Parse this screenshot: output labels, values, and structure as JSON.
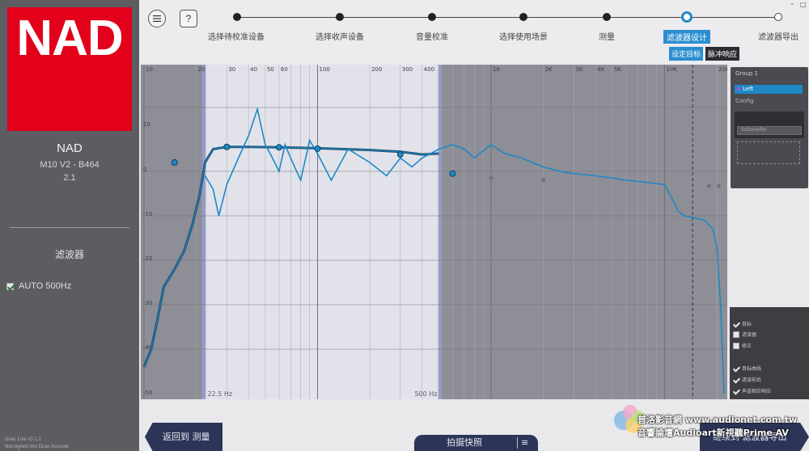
{
  "sidebar": {
    "logo_text": "NAD",
    "device_brand": "NAD",
    "device_model": "M10 V2 - B464",
    "device_channels": "2.1",
    "filters_heading": "滤波器",
    "filters": [
      {
        "label": "AUTO 500Hz",
        "checked": true
      }
    ],
    "footer_version": "Dirac Live v3.1.2",
    "footer_login": "Not signed into Dirac Account"
  },
  "header": {
    "menu_icon": "menu-icon",
    "help_label": "?",
    "window_min": "–",
    "window_max": "□",
    "steps": [
      {
        "label": "选择待校准设备",
        "state": "done"
      },
      {
        "label": "选择收声设备",
        "state": "done"
      },
      {
        "label": "音量校准",
        "state": "done"
      },
      {
        "label": "选择使用场景",
        "state": "done"
      },
      {
        "label": "测量",
        "state": "done"
      },
      {
        "label": "滤波器设计",
        "state": "active"
      },
      {
        "label": "滤波器导出",
        "state": "future"
      }
    ],
    "subtabs": {
      "target": "设定目标",
      "impulse": "脉冲响应"
    }
  },
  "plot": {
    "x_ticks": [
      "10",
      "20",
      "30",
      "40",
      "50",
      "60",
      "100",
      "200",
      "300",
      "400",
      "1K",
      "2K",
      "3K",
      "4K",
      "5K",
      "10K",
      "20K"
    ],
    "y_ticks": [
      "10",
      "0",
      "-10",
      "-20",
      "-30",
      "-40",
      "-50"
    ],
    "y_top_label": "10",
    "marker_low": "22.5 Hz",
    "marker_high": "500 Hz",
    "colors": {
      "response": "#1e88c7",
      "target": "#1f4e6e",
      "corrected": "#1e88c7"
    }
  },
  "chart_data": {
    "type": "line",
    "x_scale": "log",
    "xlim": [
      10,
      22000
    ],
    "ylim": [
      -50,
      15
    ],
    "correction_range": [
      22.5,
      500
    ],
    "series": [
      {
        "points": [
          [
            10,
            -44
          ],
          [
            11,
            -40
          ],
          [
            12,
            -33
          ],
          [
            13,
            -26
          ],
          [
            15,
            -22
          ],
          [
            17,
            -18
          ],
          [
            19,
            -12
          ],
          [
            21,
            -5
          ],
          [
            22.5,
            2
          ],
          [
            25,
            5
          ],
          [
            30,
            5.5
          ],
          [
            40,
            5.5
          ],
          [
            60,
            5.4
          ],
          [
            100,
            5.2
          ],
          [
            200,
            4.8
          ],
          [
            300,
            4.4
          ],
          [
            400,
            3.8
          ],
          [
            500,
            4
          ]
        ]
      },
      {
        "points": [
          [
            22.5,
            -1
          ],
          [
            25,
            -4
          ],
          [
            27,
            -10
          ],
          [
            30,
            -3
          ],
          [
            35,
            3
          ],
          [
            40,
            8
          ],
          [
            45,
            14
          ],
          [
            50,
            6
          ],
          [
            55,
            3
          ],
          [
            60,
            0
          ],
          [
            65,
            6
          ],
          [
            70,
            3
          ],
          [
            80,
            -2
          ],
          [
            90,
            7
          ],
          [
            100,
            4
          ],
          [
            120,
            -2
          ],
          [
            150,
            5
          ],
          [
            200,
            2
          ],
          [
            250,
            -1
          ],
          [
            300,
            3
          ],
          [
            350,
            1
          ],
          [
            400,
            3
          ],
          [
            500,
            5
          ],
          [
            600,
            6
          ],
          [
            700,
            5
          ],
          [
            800,
            3
          ],
          [
            1000,
            6
          ],
          [
            1200,
            4
          ],
          [
            1500,
            3
          ],
          [
            2000,
            1
          ],
          [
            2500,
            0
          ],
          [
            3000,
            -0.5
          ],
          [
            4000,
            -1
          ],
          [
            5000,
            -1.5
          ],
          [
            6000,
            -2
          ],
          [
            8000,
            -2.5
          ],
          [
            10000,
            -3
          ],
          [
            11000,
            -6
          ],
          [
            12000,
            -9
          ],
          [
            13000,
            -10
          ],
          [
            15000,
            -10.5
          ],
          [
            17000,
            -11
          ],
          [
            19000,
            -13
          ],
          [
            20000,
            -17
          ],
          [
            21000,
            -30
          ],
          [
            22000,
            -50
          ]
        ]
      }
    ]
  },
  "rpanel": {
    "group_label": "Group 1",
    "group_item": "Left",
    "group_sub": "Config",
    "field_placeholder": "Subwoofer",
    "options": [
      {
        "label": "目标",
        "checked": true
      },
      {
        "label": "滤波器",
        "checked": false
      },
      {
        "label": "修正",
        "checked": false
      },
      {
        "label": "目标曲线",
        "checked": true
      },
      {
        "label": "滤波前后",
        "checked": true
      },
      {
        "label": "声道相位响应",
        "checked": true
      }
    ]
  },
  "bottom": {
    "back_label": "返回到 测量",
    "snapshot_label": "拍摄快照",
    "next_label": "继续到 滤波器导出",
    "watermark_line1": "普洛影音網 www.audionet.com.tw",
    "watermark_line2": "音響論壇Audioart新視聽Prime AV"
  }
}
